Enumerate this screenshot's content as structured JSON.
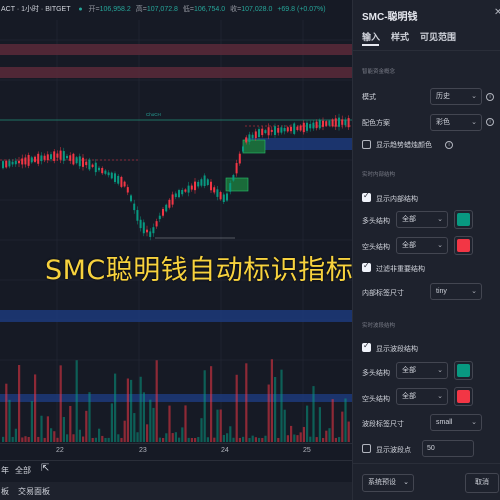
{
  "chart": {
    "symbol": "ACT · 1小时 · BITGET",
    "ohlc": [
      {
        "k": "开=",
        "v": "106,958.2"
      },
      {
        "k": "高=",
        "v": "107,072.8"
      },
      {
        "k": "低=",
        "v": "106,754.0"
      },
      {
        "k": "收=",
        "v": "107,028.0"
      },
      {
        "k": "",
        "v": "+69.8 (+0.07%)"
      }
    ],
    "overlay_title": "SMC聪明钱自动标识指标",
    "zone_labels": {
      "choch": "ChoCH"
    },
    "x_ticks": [
      "22",
      "23",
      "24",
      "25"
    ],
    "bottom_bar1": {
      "left": "年",
      "range": "全部",
      "icon": "calendar-go-to-icon"
    },
    "bottom_bar2": {
      "left": "板",
      "trading_panel": "交易面板"
    }
  },
  "panel": {
    "title": "SMC-聪明钱",
    "close": "✕",
    "tabs": [
      "输入",
      "样式",
      "可见范围"
    ],
    "sec_smart_money": "智能资金概念",
    "mode_label": "模式",
    "mode_value": "历史",
    "color_scheme_label": "配色方案",
    "color_scheme_value": "彩色",
    "trend_candle_label": "显示趋势蜡烛颜色",
    "sec_internal": "实时内部结构",
    "show_internal_label": "显示内部结构",
    "bull_structure_label": "多头结构",
    "bull_structure_value": "全部",
    "bear_structure_label": "空头结构",
    "bear_structure_value": "全部",
    "filter_minor_label": "过滤非重要结构",
    "internal_label_size_label": "内部标签尺寸",
    "internal_label_size_value": "tiny",
    "sec_swing": "实时波段结构",
    "show_swing_label": "显示波段结构",
    "swing_bull_label": "多头结构",
    "swing_bull_value": "全部",
    "swing_bear_label": "空头结构",
    "swing_bear_value": "全部",
    "swing_label_size_label": "波段标签尺寸",
    "swing_label_size_value": "small",
    "show_swing_points_label": "显示波段点",
    "swing_points_value": "50",
    "preset_label": "系统预设",
    "cancel_label": "取消"
  },
  "colors": {
    "bull": "#089981",
    "bear": "#f23645",
    "accent": "#f7d23e",
    "zone": "#5b2a3a",
    "blue_zone": "#1c3a7a"
  }
}
